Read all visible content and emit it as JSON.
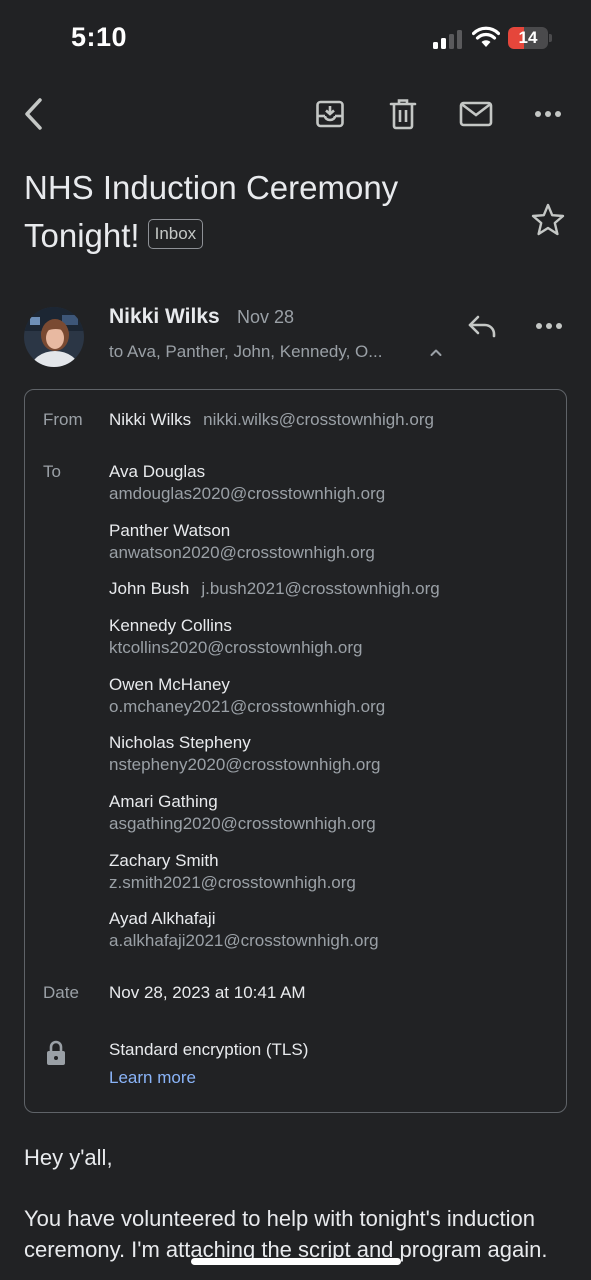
{
  "status_bar": {
    "time": "5:10",
    "battery_level": "14",
    "battery_fraction": 0.14,
    "battery_color": "#e5463b"
  },
  "toolbar": {
    "back_icon": "chevron-left-icon",
    "archive_icon": "archive-icon",
    "delete_icon": "trash-icon",
    "mark_unread_icon": "mail-icon",
    "more_icon": "more-horizontal-icon"
  },
  "email": {
    "subject": "NHS Induction Ceremony Tonight!",
    "label": "Inbox",
    "sender": {
      "name": "Nikki Wilks",
      "email": "nikki.wilks@crosstownhigh.org",
      "date_short": "Nov 28"
    },
    "recipients_summary": "to Ava, Panther, John, Kennedy, O...",
    "details": {
      "from_label": "From",
      "to_label": "To",
      "date_label": "Date",
      "recipients": [
        {
          "name": "Ava Douglas",
          "email": "amdouglas2020@crosstownhigh.org"
        },
        {
          "name": "Panther Watson",
          "email": "anwatson2020@crosstownhigh.org"
        },
        {
          "name": "John Bush",
          "email": "j.bush2021@crosstownhigh.org"
        },
        {
          "name": "Kennedy Collins",
          "email": "ktcollins2020@crosstownhigh.org"
        },
        {
          "name": "Owen McHaney",
          "email": "o.mchaney2021@crosstownhigh.org"
        },
        {
          "name": "Nicholas Stepheny",
          "email": "nstepheny2020@crosstownhigh.org"
        },
        {
          "name": "Amari Gathing",
          "email": "asgathing2020@crosstownhigh.org"
        },
        {
          "name": "Zachary Smith",
          "email": "z.smith2021@crosstownhigh.org"
        },
        {
          "name": "Ayad Alkhafaji",
          "email": "a.alkhafaji2021@crosstownhigh.org"
        }
      ],
      "date": "Nov 28, 2023 at 10:41 AM",
      "encryption": "Standard encryption (TLS)",
      "learn_more": "Learn more"
    },
    "body": {
      "greeting": "Hey y'all,",
      "paragraph": "You have volunteered to help with tonight's induction ceremony. I'm attaching the script and program again."
    }
  },
  "colors": {
    "background": "#212224",
    "link": "#8ab4f8",
    "secondary_text": "#9aa0a6"
  }
}
